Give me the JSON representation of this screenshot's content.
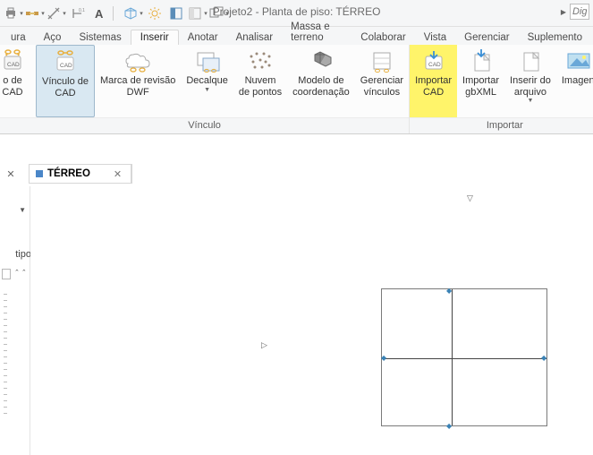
{
  "title": "Projeto2 - Planta de piso: TÉRREO",
  "search_placeholder": "Dig",
  "tabs": {
    "t0": "ura",
    "t1": "Aço",
    "t2": "Sistemas",
    "t3": "Inserir",
    "t4": "Anotar",
    "t5": "Analisar",
    "t6": "Massa e terreno",
    "t7": "Colaborar",
    "t8": "Vista",
    "t9": "Gerenciar",
    "t10": "Suplemento"
  },
  "ribbon": {
    "group_vinculo": "Vínculo",
    "group_importar": "Importar",
    "btn_partial_left": "o de\nCAD",
    "btn_vinculo_cad": "Vínculo de\nCAD",
    "btn_marca_rev": "Marca de revisão\nDWF",
    "btn_decalque": "Decalque",
    "btn_nuvem": "Nuvem\nde pontos",
    "btn_modelo": "Modelo de\ncoordenação",
    "btn_gerenciar": "Gerenciar\nvínculos",
    "btn_importar_cad": "Importar\nCAD",
    "btn_importar_gbxml": "Importar\ngbXML",
    "btn_inserir_arq": "Inserir do\narquivo",
    "btn_imagem": "Imagen"
  },
  "viewtabs": {
    "tab0": "TÉRREO"
  },
  "palette": {
    "type_label": "tipo"
  }
}
